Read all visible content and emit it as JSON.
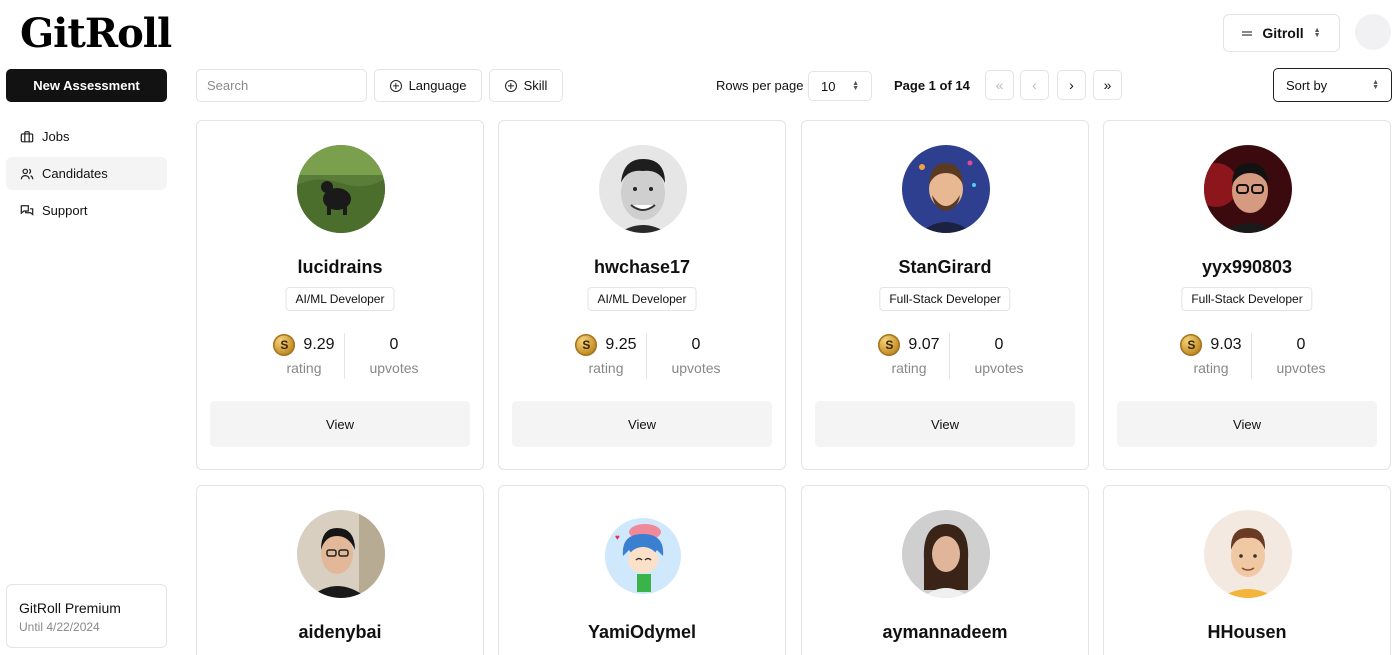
{
  "app": {
    "logo": "GitRoll"
  },
  "account": {
    "label": "Gitroll"
  },
  "sidebar": {
    "new_button": "New Assessment",
    "items": [
      {
        "label": "Jobs",
        "icon": "briefcase-icon",
        "active": false
      },
      {
        "label": "Candidates",
        "icon": "users-icon",
        "active": true
      },
      {
        "label": "Support",
        "icon": "messages-icon",
        "active": false
      }
    ],
    "premium": {
      "title": "GitRoll Premium",
      "subtitle": "Until 4/22/2024"
    }
  },
  "toolbar": {
    "search_placeholder": "Search",
    "language_label": "Language",
    "skill_label": "Skill",
    "rows_label": "Rows per page",
    "rows_value": "10",
    "page_label": "Page 1 of 14",
    "sort_label": "Sort by",
    "first_glyph": "«",
    "prev_glyph": "‹",
    "next_glyph": "›",
    "last_glyph": "»"
  },
  "cards": [
    {
      "name": "lucidrains",
      "role": "AI/ML Developer",
      "rating": "9.29",
      "rating_label": "rating",
      "upvotes": "0",
      "upvotes_label": "upvotes",
      "view_label": "View"
    },
    {
      "name": "hwchase17",
      "role": "AI/ML Developer",
      "rating": "9.25",
      "rating_label": "rating",
      "upvotes": "0",
      "upvotes_label": "upvotes",
      "view_label": "View"
    },
    {
      "name": "StanGirard",
      "role": "Full-Stack Developer",
      "rating": "9.07",
      "rating_label": "rating",
      "upvotes": "0",
      "upvotes_label": "upvotes",
      "view_label": "View"
    },
    {
      "name": "yyx990803",
      "role": "Full-Stack Developer",
      "rating": "9.03",
      "rating_label": "rating",
      "upvotes": "0",
      "upvotes_label": "upvotes",
      "view_label": "View"
    },
    {
      "name": "aidenybai"
    },
    {
      "name": "YamiOdymel"
    },
    {
      "name": "aymannadeem"
    },
    {
      "name": "HHousen"
    }
  ],
  "coin_letter": "S",
  "colors": {
    "primary": "#121212",
    "border": "#e4e4e7",
    "muted": "#888888",
    "button_bg": "#f4f4f5"
  }
}
